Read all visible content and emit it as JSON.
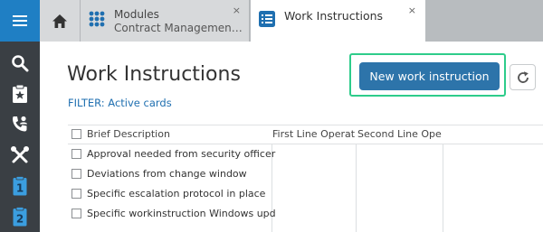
{
  "sidebar": {
    "items": [
      {
        "icon": "search-icon"
      },
      {
        "icon": "clipboard-star-icon"
      },
      {
        "icon": "phone-user-icon"
      },
      {
        "icon": "tools-icon"
      },
      {
        "icon": "clipboard-one-icon",
        "label": "1"
      },
      {
        "icon": "clipboard-two-icon",
        "label": "2"
      }
    ]
  },
  "tabs": [
    {
      "line1": "Modules",
      "line2": "Contract Managemen…",
      "close": "×",
      "icon": "modules-icon"
    },
    {
      "line1": "Work Instructions",
      "close": "×",
      "icon": "list-icon"
    }
  ],
  "page": {
    "title": "Work Instructions",
    "filter": "FILTER: Active cards",
    "new_button": "New work instruction"
  },
  "table": {
    "columns": [
      "Brief Description",
      "First Line Operato",
      "Second Line Oper"
    ],
    "rows": [
      {
        "description": "Approval needed from security officer"
      },
      {
        "description": "Deviations from change window"
      },
      {
        "description": "Specific escalation protocol in place"
      },
      {
        "description": "Specific workinstruction Windows upd"
      }
    ]
  },
  "colors": {
    "sidebar_bg": "#3a3f44",
    "menu_button": "#1f7fc4",
    "primary_button": "#2d74aa",
    "highlight_border": "#2ecc8b",
    "filter_text": "#1f6fb0",
    "sidebar_badge": "#3b9ee0"
  }
}
